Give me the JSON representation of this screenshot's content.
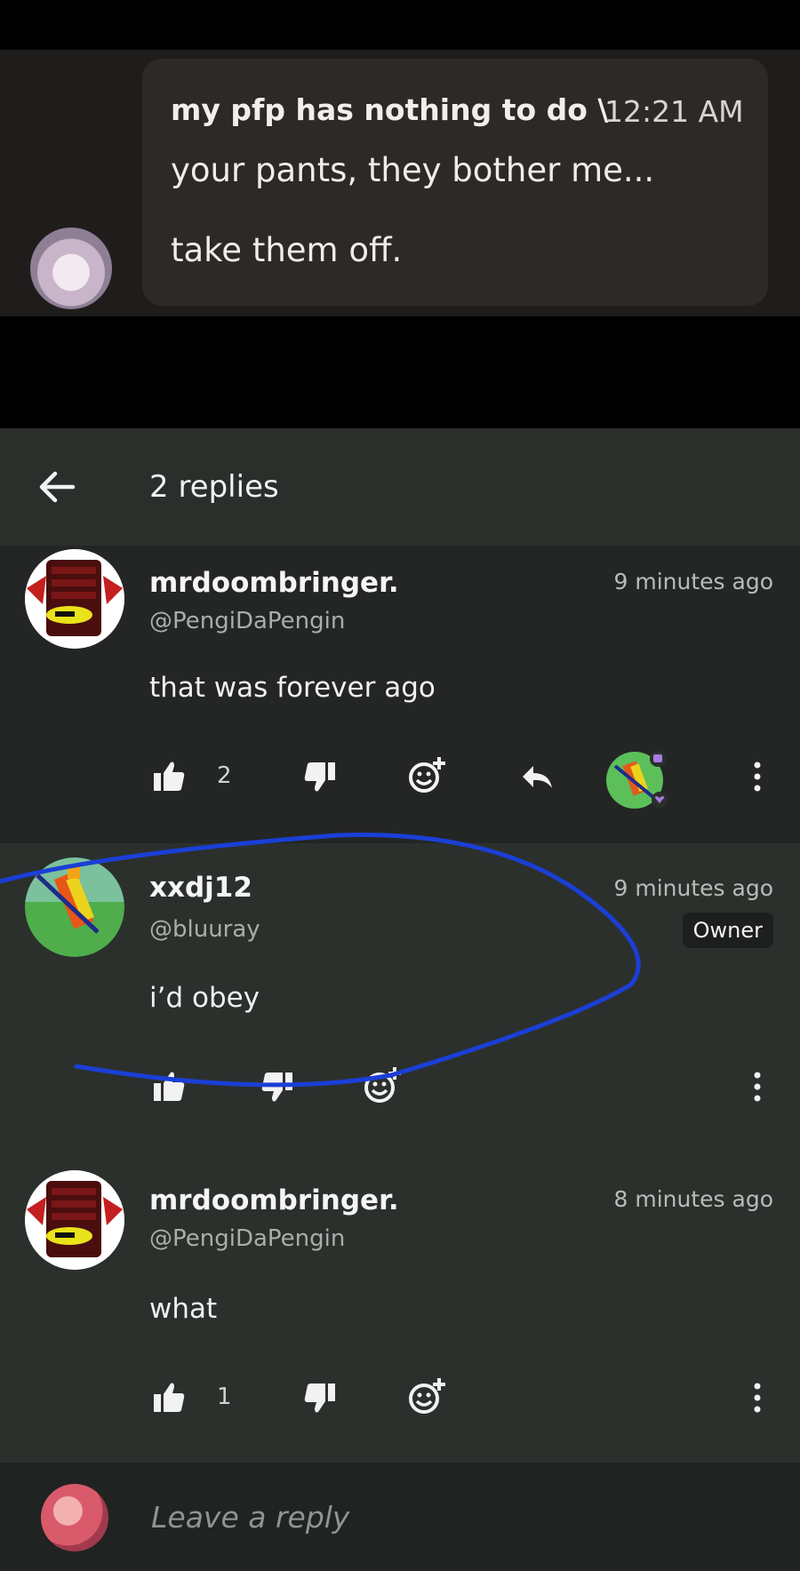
{
  "top_screenshot": {
    "header_text": "my pfp has nothing to do \\",
    "time": "12:21 AM",
    "line1": "your pants, they bother me...",
    "line2": "take them off."
  },
  "header": {
    "title": "2 replies"
  },
  "comments": [
    {
      "username": "mrdoombringer.",
      "handle": "@PengiDaPengin",
      "time": "9 minutes ago",
      "text": "that was forever ago",
      "likes": "2"
    },
    {
      "username": "xxdj12",
      "handle": "@bluuray",
      "time": "9 minutes ago",
      "badge": "Owner",
      "text": "i’d obey",
      "likes": ""
    },
    {
      "username": "mrdoombringer.",
      "handle": "@PengiDaPengin",
      "time": "8 minutes ago",
      "text": "what",
      "likes": "1"
    }
  ],
  "reply_bar": {
    "placeholder": "Leave a reply"
  },
  "colors": {
    "background": "#232625",
    "highlight_section": "#2b302c",
    "annotation": "#1b3fd6"
  }
}
